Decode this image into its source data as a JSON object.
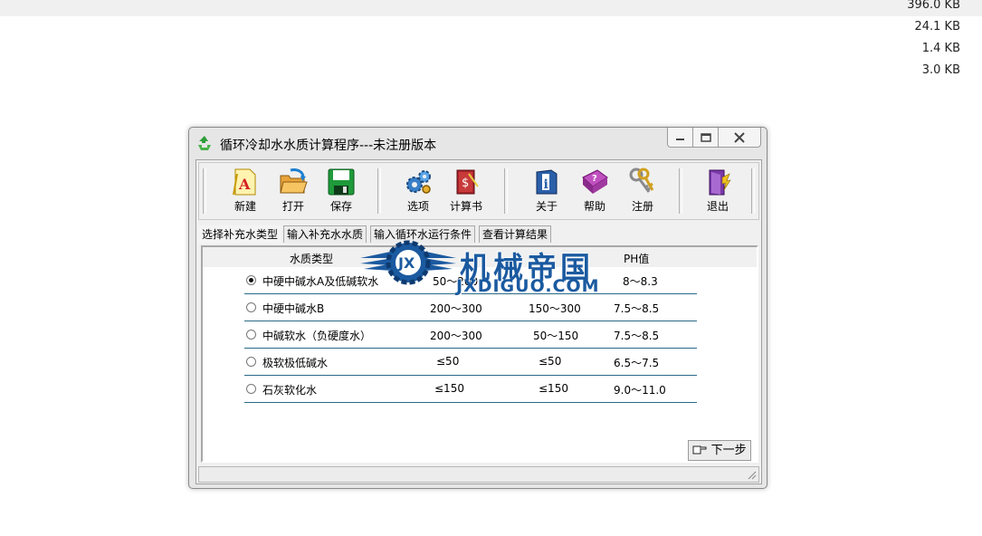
{
  "background_list": {
    "sizes": [
      "396.0 KB",
      "24.1 KB",
      "1.4 KB",
      "3.0 KB"
    ]
  },
  "window": {
    "title": "循环冷却水水质计算程序---未注册版本",
    "icon": "recycle-icon",
    "controls": {
      "minimize": "minimize-icon",
      "maximize": "maximize-icon",
      "close": "close-icon"
    }
  },
  "toolbar": {
    "new_label": "新建",
    "open_label": "打开",
    "save_label": "保存",
    "options_label": "选项",
    "calcbook_label": "计算书",
    "about_label": "关于",
    "help_label": "帮助",
    "register_label": "注册",
    "exit_label": "退出"
  },
  "tabs": [
    {
      "label": "选择补充水类型",
      "active": true
    },
    {
      "label": "输入补充水水质",
      "active": false
    },
    {
      "label": "输入循环水运行条件",
      "active": false
    },
    {
      "label": "查看计算结果",
      "active": false
    }
  ],
  "table": {
    "headers": {
      "type": "水质类型",
      "ph": "PH值"
    },
    "rows": [
      {
        "type": "中硬中碱水A及低碱软水",
        "col2": "50～200",
        "col3": "",
        "ph": "8～8.3",
        "selected": true
      },
      {
        "type": "中硬中碱水B",
        "col2": "200～300",
        "col3": "150～300",
        "ph": "7.5～8.5",
        "selected": false
      },
      {
        "type": "中碱软水（负硬度水）",
        "col2": "200～300",
        "col3": "50～150",
        "ph": "7.5～8.5",
        "selected": false
      },
      {
        "type": "极软极低碱水",
        "col2": "≤50",
        "col3": "≤50",
        "ph": "6.5～7.5",
        "selected": false
      },
      {
        "type": "石灰软化水",
        "col2": "≤150",
        "col3": "≤150",
        "ph": "9.0～11.0",
        "selected": false
      }
    ]
  },
  "next_button_label": "下一步",
  "watermark": {
    "main": "机械帝国",
    "sub": "JXDIGUO.COM",
    "badge": "JX"
  }
}
